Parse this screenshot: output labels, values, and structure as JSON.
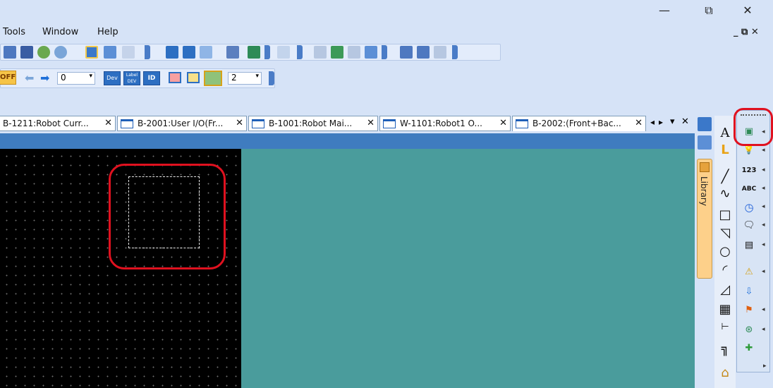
{
  "window": {
    "minimize": "—",
    "restore": "⧉",
    "close": "✕"
  },
  "menu": {
    "items": [
      "Tools",
      "Window",
      "Help"
    ],
    "mdi_controls": "_ ⧉ ✕"
  },
  "toolbar2": {
    "off_label": "OFF",
    "number_value": "0",
    "dev_label": "Dev",
    "label_dev": "Label DEV",
    "id_label": "ID",
    "zoom_value": "2"
  },
  "tabs": [
    {
      "label": "B-1211:Robot Curr...",
      "close": "✕"
    },
    {
      "label": "B-2001:User I/O(Fr...",
      "close": "✕"
    },
    {
      "label": "B-1001:Robot Mai...",
      "close": "✕"
    },
    {
      "label": "W-1101:Robot1 O...",
      "close": "✕"
    },
    {
      "label": "B-2002:(Front+Bac...",
      "close": "✕"
    }
  ],
  "tab_nav": {
    "prev": "◂",
    "next": "▸",
    "list": "▾",
    "close": "✕"
  },
  "library": {
    "label": "Library"
  },
  "draw_tools": [
    "A",
    "L",
    "╱",
    "∿",
    "□",
    "◹",
    "○",
    "◜",
    "◿",
    "▦",
    "⊢",
    "╗",
    "⌂"
  ],
  "object_tools": [
    "▣",
    "💡",
    "123",
    "ABC",
    "◷",
    "🗨",
    "▤",
    "⚠",
    "⇩",
    "⚑",
    "⊛",
    "✚"
  ],
  "colors": {
    "highlight": "#e0111f",
    "canvas": "#000000",
    "workspace": "#4a9c9c",
    "header": "#3f7cbf"
  }
}
